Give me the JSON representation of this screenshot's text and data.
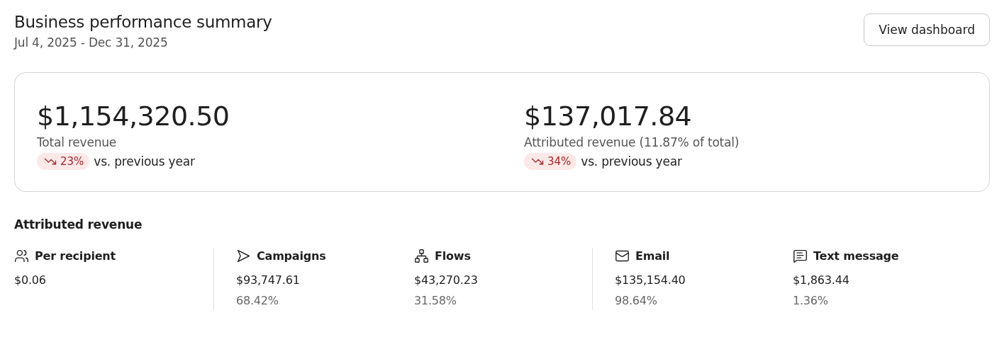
{
  "header": {
    "title": "Business performance summary",
    "date_range": "Jul 4, 2025 - Dec 31, 2025",
    "button": "View dashboard"
  },
  "summary": [
    {
      "value": "$1,154,320.50",
      "label": "Total revenue",
      "change": {
        "decrease": true,
        "percent": "23%",
        "comparison": "vs. previous year"
      }
    },
    {
      "value": "$137,017.84",
      "label": "Attributed revenue (11.87% of total)",
      "change": {
        "decrease": true,
        "percent": "34%",
        "comparison": "vs. previous year"
      }
    }
  ],
  "attributed": {
    "title": "Attributed revenue",
    "groups": [
      {
        "metrics": [
          {
            "kind": "recipient",
            "label": "Per recipient",
            "value": "$0.06"
          }
        ]
      },
      {
        "metrics": [
          {
            "kind": "campaign",
            "label": "Campaigns",
            "value": "$93,747.61",
            "share": "68.42%"
          },
          {
            "kind": "flow",
            "label": "Flows",
            "value": "$43,270.23",
            "share": "31.58%"
          }
        ]
      },
      {
        "metrics": [
          {
            "kind": "email",
            "label": "Email",
            "value": "$135,154.40",
            "share": "98.64%"
          },
          {
            "kind": "sms",
            "label": "Text message",
            "value": "$1,863.44",
            "share": "1.36%"
          }
        ]
      }
    ]
  }
}
